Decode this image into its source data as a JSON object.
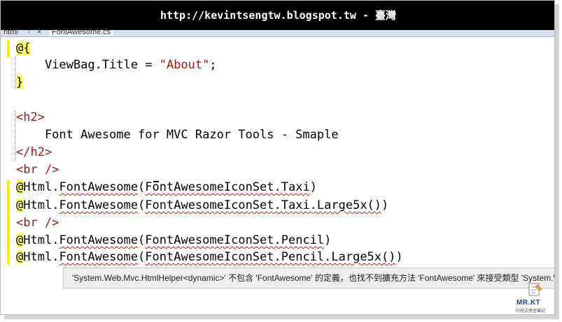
{
  "watermark": {
    "text": "http://kevintsengtw.blogspot.tw - 臺灣"
  },
  "tabs": {
    "file1": "html",
    "pin": "⊤",
    "close": "×",
    "file2": "FontAwesome.cs"
  },
  "code": {
    "l1_razor": "@{",
    "l2_prop": "    ViewBag.Title = ",
    "l2_string": "\"About\"",
    "l2_semi": ";",
    "l3_razor": "}",
    "l5_tag": "<h2>",
    "l6_text": "    Font Awesome for MVC Razor Tools - Smaple",
    "l7_tag": "</h2>",
    "l8_tag": "<br />",
    "l9": {
      "at": "@",
      "obj": "Html.",
      "method": "FontAwesome",
      "open": "(",
      "arg": "FontAwesomeIconSet.Taxi",
      "close": ")"
    },
    "l10": {
      "at": "@",
      "obj": "Html.",
      "method": "FontAwesome",
      "open": "(",
      "arg": "FontAwesomeIconSet.Taxi.Large5x()",
      "close": ")"
    },
    "l11_tag": "<br />",
    "l12": {
      "at": "@",
      "obj": "Html.",
      "method": "FontAwesome",
      "open": "(",
      "arg": "FontAwesomeIconSet.Pencil",
      "close": ")"
    },
    "l13": {
      "at": "@",
      "obj": "Html.",
      "method": "FontAwesome",
      "open": "(",
      "arg": "FontAwesomeIconSet.Pencil.Large5x()",
      "close": ")"
    }
  },
  "tooltip": {
    "text": "'System.Web.Mvc.HtmlHelper<dynamic>' 不包含 'FontAwesome' 的定義，也找不到擴充方法 'FontAwesome' 來接受類型 'System.Web.Mvc.HtmlHelper<dynamic>'"
  },
  "logo": {
    "text": "MR.KT",
    "sub": "的程式學習筆記"
  },
  "colors": {
    "razor_highlight": "#ffff66",
    "html_tag": "#a31515",
    "string": "#a31515",
    "error_squiggle": "#e51400",
    "change_bar": "#ffef00"
  }
}
